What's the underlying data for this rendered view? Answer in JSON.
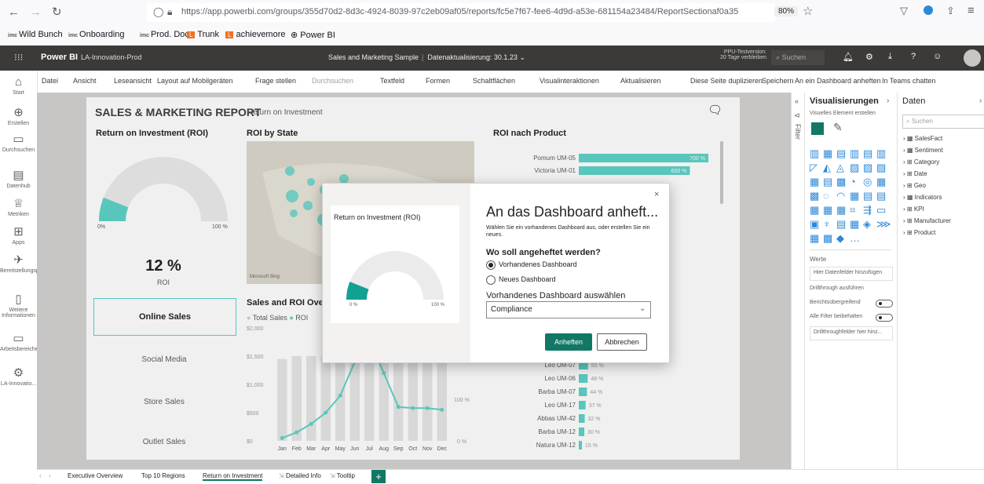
{
  "browser": {
    "url": "https://app.powerbi.com/groups/355d70d2-8d3c-4924-8039-97c2eb09af05/reports/fc5e7f67-fee6-4d9d-a53e-681154a23484/ReportSectionaf0a35",
    "zoom": "80%",
    "bookmarks": [
      "Wild Bunch",
      "Onboarding",
      "Prod. Doc.",
      "Trunk",
      "achievemore",
      "Power BI"
    ]
  },
  "header": {
    "brand": "Power BI",
    "workspace": "LA-Innovation-Prod",
    "report_title": "Sales and Marketing Sample",
    "refresh": "Datenaktualisierung: 30.1.23",
    "trial_line1": "PPU-Testversion:",
    "trial_line2": "20 Tage verbleiben",
    "search_placeholder": "Suchen"
  },
  "ribbon": [
    "Datei",
    "Ansicht",
    "Leseansicht",
    "Layout auf Mobilgeräten",
    "Frage stellen",
    "Durchsuchen",
    "Textfeld",
    "Formen",
    "Schaltflächen",
    "Visualinteraktionen",
    "Aktualisieren",
    "Diese Seite duplizieren",
    "Speichern",
    "An ein Dashboard anheften",
    "In Teams chatten"
  ],
  "leftnav": [
    "Start",
    "Erstellen",
    "Durchsuchen",
    "Datenhub",
    "Metriken",
    "Apps",
    "Bereitstellungspipelines",
    "Weitere Informationen",
    "Arbeitsbereiche",
    "LA-Innovatio..."
  ],
  "report": {
    "title": "SALES & MARKETING REPORT",
    "subtitle": "Return on Investment",
    "roi_title": "Return on Investment (ROI)",
    "gauge_min": "0%",
    "gauge_max": "100 %",
    "kpi_value": "12 %",
    "kpi_label": "ROI",
    "buttons": [
      "Online Sales",
      "Social Media",
      "Store Sales",
      "Outlet Sales"
    ],
    "map_title": "ROI by State",
    "map_label": "Microsoft Bing",
    "line_title": "Sales and ROI Over T",
    "legend_total": "Total Sales",
    "legend_roi": "ROI",
    "y_ticks": [
      "$2,000",
      "$1,500",
      "$1,000",
      "$500",
      "$0"
    ],
    "right_ticks": [
      "100 %",
      "0 %"
    ],
    "months": [
      "Jan",
      "Feb",
      "Mar",
      "Apr",
      "May",
      "Jun",
      "Jul",
      "Aug",
      "Sep",
      "Oct",
      "Nov",
      "Dec"
    ],
    "product_title": "ROI nach Product"
  },
  "chart_data": [
    {
      "type": "bar",
      "title": "ROI nach Product",
      "categories": [
        "Pomum UM-05",
        "Victoria UM-01",
        "Leo UM-07",
        "Leo UM-06",
        "Barba UM-07",
        "Leo UM-17",
        "Abbas UM-42",
        "Barba UM-12",
        "Natura UM-12"
      ],
      "values": [
        700,
        600,
        50,
        48,
        44,
        37,
        32,
        30,
        15
      ],
      "value_labels": [
        "700 %",
        "600 %",
        "50 %",
        "48 %",
        "44 %",
        "37 %",
        "32 %",
        "30 %",
        "15 %"
      ]
    },
    {
      "type": "line",
      "title": "Sales and ROI Over T",
      "categories": [
        "Jan",
        "Feb",
        "Mar",
        "Apr",
        "May",
        "Jun",
        "Jul",
        "Aug",
        "Sep",
        "Oct",
        "Nov",
        "Dec"
      ],
      "series": [
        {
          "name": "Total Sales",
          "values": [
            1450,
            1500,
            1500,
            1500,
            1500,
            1500,
            1500,
            1500,
            1500,
            1500,
            1500,
            1500
          ]
        },
        {
          "name": "ROI",
          "values": [
            5,
            15,
            30,
            50,
            80,
            140,
            180,
            120,
            60,
            58,
            58,
            55
          ]
        }
      ],
      "ylim": [
        0,
        2000
      ]
    }
  ],
  "dialog": {
    "title": "An das Dashboard anheft...",
    "description": "Wählen Sie ein vorhandenes Dashboard aus, oder erstellen Sie ein neues.",
    "question": "Wo soll angeheftet werden?",
    "option_existing": "Vorhandenes Dashboard",
    "option_new": "Neues Dashboard",
    "select_label": "Vorhandenes Dashboard auswählen",
    "select_value": "Compliance",
    "preview_title": "Return on Investment (ROI)",
    "preview_min": "0 %",
    "preview_max": "100 %",
    "pin_button": "Anheften",
    "cancel_button": "Abbrechen"
  },
  "viz_pane": {
    "title": "Visualisierungen",
    "build_label": "Visuelles Element erstellen",
    "filter_label": "Filter",
    "values_section": "Werte",
    "values_placeholder": "Hier Datenfelder hinzufügen",
    "drillthrough": "Drillthrough ausführen",
    "cross_report": "Berichtsübergreifend",
    "keep_filters": "Alle Filter beibehalten",
    "drill_placeholder": "Drillthroughfelder hier hinz..."
  },
  "data_pane": {
    "title": "Daten",
    "search_placeholder": "Suchen",
    "fields": [
      "SalesFact",
      "Sentiment",
      "Category",
      "Date",
      "Geo",
      "Indicators",
      "KPI",
      "Manufacturer",
      "Product"
    ]
  },
  "tabs": [
    "Executive Overview",
    "Top 10 Regions",
    "Return on Investment",
    "Detailed Info",
    "Tooltip"
  ],
  "colors": {
    "teal": "#5fd3c8",
    "dark_teal": "#11a193",
    "pin_green": "#117865"
  }
}
